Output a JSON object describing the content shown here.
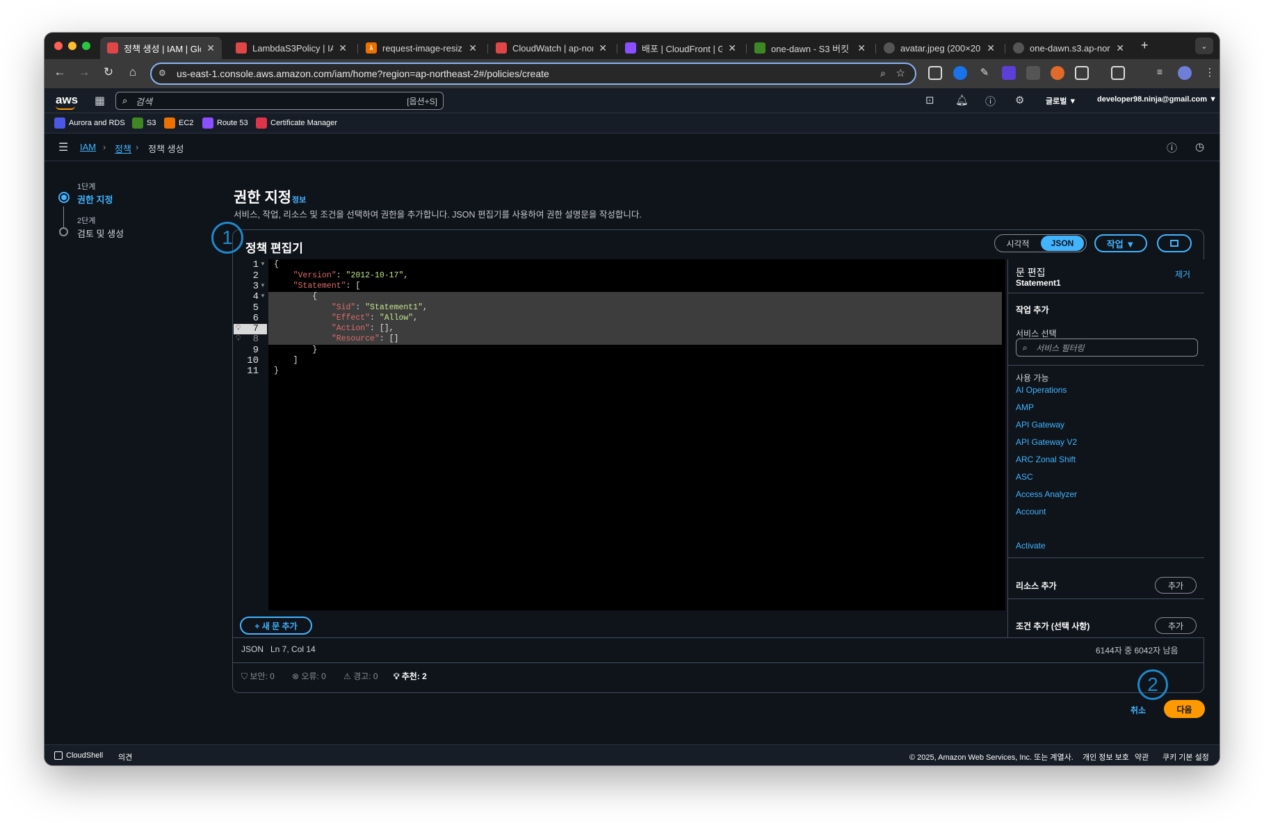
{
  "browser": {
    "tabs": [
      {
        "title": "정책 생성 | IAM | Globa",
        "color": "#e04646"
      },
      {
        "title": "LambdaS3Policy | IAM",
        "color": "#e04646"
      },
      {
        "title": "request-image-resiz",
        "color": "#ed7100"
      },
      {
        "title": "CloudWatch | ap-nor",
        "color": "#e04646"
      },
      {
        "title": "배포 | CloudFront | Gl",
        "color": "#8c4fff"
      },
      {
        "title": "one-dawn - S3 버킷 |",
        "color": "#3f8624"
      },
      {
        "title": "avatar.jpeg (200×20",
        "color": "#8a8a8a"
      },
      {
        "title": "one-dawn.s3.ap-nort",
        "color": "#8a8a8a"
      }
    ],
    "url": "us-east-1.console.aws.amazon.com/iam/home?region=ap-northeast-2#/policies/create"
  },
  "aws_header": {
    "logo": "aws",
    "search_placeholder": "검색",
    "search_shortcut": "[옵션+S]",
    "region": "글로벌 ▼",
    "account": "developer98.ninja@gmail.com ▼"
  },
  "favorites": [
    {
      "label": "Aurora and RDS",
      "color": "#4d57e6"
    },
    {
      "label": "S3",
      "color": "#3f8624"
    },
    {
      "label": "EC2",
      "color": "#ed7100"
    },
    {
      "label": "Route 53",
      "color": "#8c4fff"
    },
    {
      "label": "Certificate Manager",
      "color": "#dd344c"
    }
  ],
  "breadcrumb": {
    "iam": "IAM",
    "policies": "정책",
    "current": "정책 생성"
  },
  "steps": [
    {
      "num": "1단계",
      "label": "권한 지정"
    },
    {
      "num": "2단계",
      "label": "검토 및 생성"
    }
  ],
  "page": {
    "title": "권한 지정",
    "info": "정보",
    "description": "서비스, 작업, 리소스 및 조건을 선택하여 권한을 추가합니다. JSON 편집기를 사용하여 권한 설명문을 작성합니다."
  },
  "editor": {
    "title": "정책 편집기",
    "segment_visual": "시각적",
    "segment_json": "JSON",
    "actions_button": "작업 ▼",
    "line_numbers": [
      "1",
      "2",
      "3",
      "4",
      "5",
      "6",
      "7",
      "8",
      "9",
      "10",
      "11"
    ],
    "add_statement": "+ 새 문 추가",
    "status_lang": "JSON",
    "status_pos": "Ln 7, Col 14",
    "char_count": "6144자 중 6042자 남음",
    "security": "보안: 0",
    "errors": "오류: 0",
    "warnings": "경고: 0",
    "suggestions": "추천: 2"
  },
  "sidebar": {
    "edit_statement": "문 편집",
    "statement_name": "Statement1",
    "remove": "제거",
    "add_actions": "작업 추가",
    "select_service": "서비스 선택",
    "filter_placeholder": "서비스 필터링",
    "available": "사용 가능",
    "services": [
      "AI Operations",
      "AMP",
      "API Gateway",
      "API Gateway V2",
      "ARC Zonal Shift",
      "ASC",
      "Access Analyzer",
      "Account",
      "Activate"
    ],
    "add_resource": "리소스 추가",
    "add_condition": "조건 추가 (선택 사항)",
    "add_button": "추가"
  },
  "annotations": {
    "one": "1",
    "two": "2"
  },
  "bottom_buttons": {
    "cancel": "취소",
    "next": "다음"
  },
  "footer": {
    "cloudshell": "CloudShell",
    "feedback": "의견",
    "copyright": "© 2025, Amazon Web Services, Inc. 또는 계열사.",
    "privacy": "개인 정보 보호",
    "terms": "약관",
    "cookies": "쿠키 기본 설정"
  }
}
